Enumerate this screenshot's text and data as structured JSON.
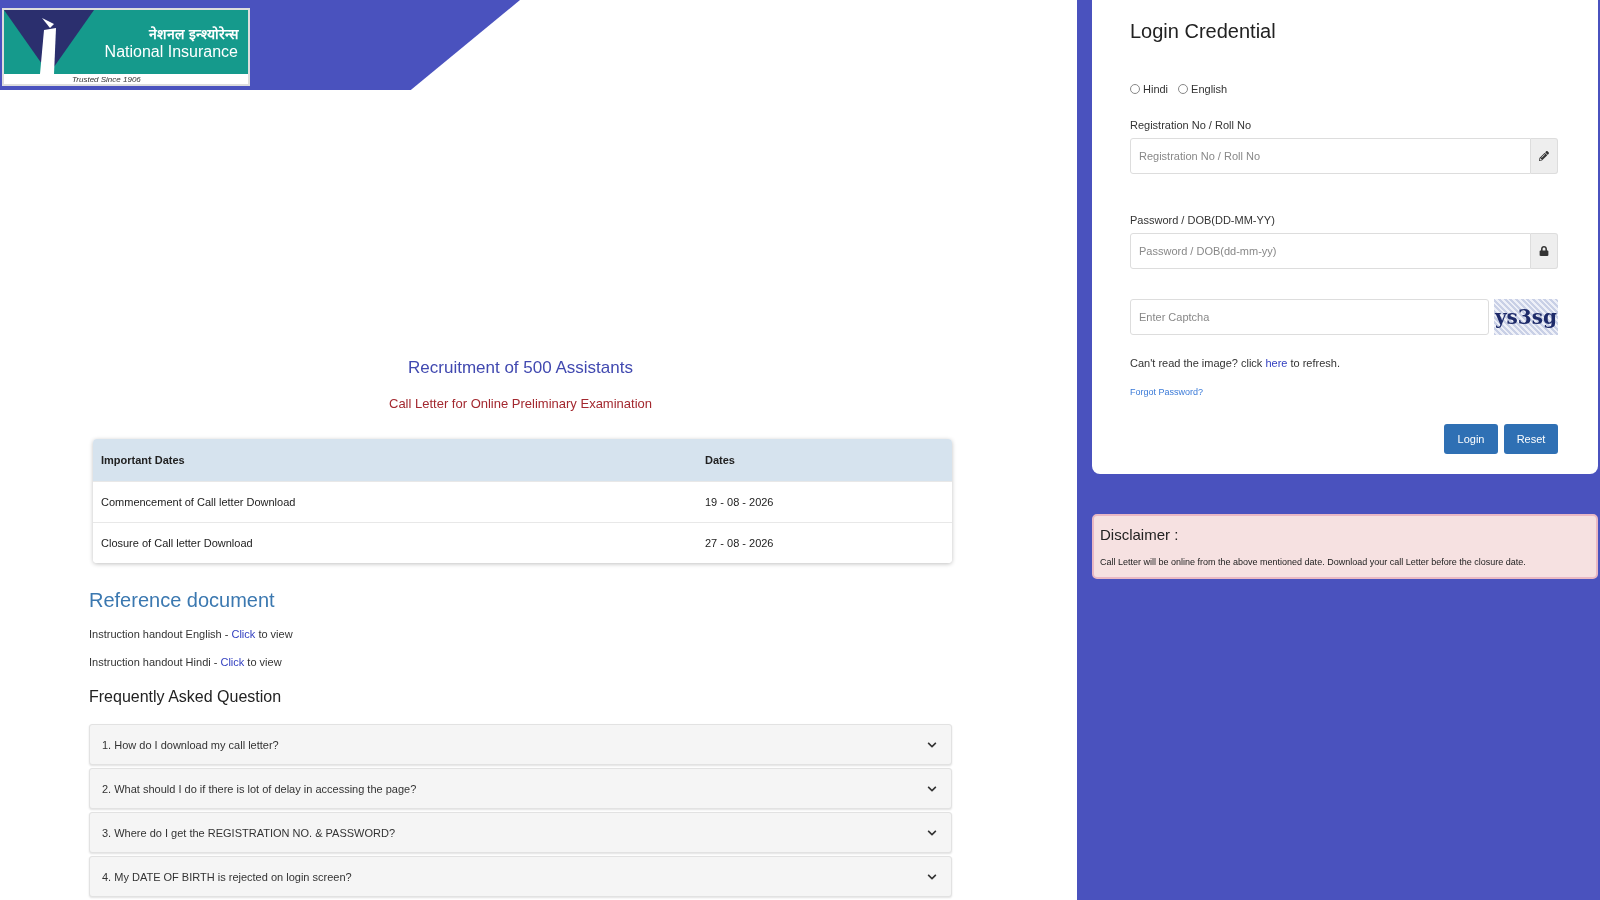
{
  "logo": {
    "hindi": "नेशनल इन्श्योरेन्स",
    "english": "National Insurance",
    "tagline": "Trusted Since 1906"
  },
  "title": "Recruitment of 500 Assistants",
  "subtitle": "Call Letter for Online Preliminary Examination",
  "table": {
    "columns": [
      "Important Dates",
      "Dates"
    ],
    "rows": [
      [
        "Commencement of Call letter Download",
        "19 - 08 - 2026"
      ],
      [
        "Closure of Call letter Download",
        "27 - 08 - 2026"
      ]
    ]
  },
  "reference": {
    "heading": "Reference document",
    "items": [
      {
        "before": "Instruction handout English - ",
        "link": "Click",
        "after": " to view"
      },
      {
        "before": "Instruction handout Hindi - ",
        "link": "Click",
        "after": " to view"
      }
    ]
  },
  "faq": {
    "heading": "Frequently Asked Question",
    "items": [
      {
        "question": "1. How do I download my call letter?",
        "expanded": false
      },
      {
        "question": "2. What should I do if there is lot of delay in accessing the page?",
        "expanded": false
      },
      {
        "question": "3. Where do I get the REGISTRATION NO. & PASSWORD?",
        "expanded": false
      },
      {
        "question": "4. My DATE OF BIRTH is rejected on login screen?",
        "expanded": false
      }
    ]
  },
  "login": {
    "title": "Login Credential",
    "languages": [
      {
        "label": "Hindi",
        "selected": false
      },
      {
        "label": "English",
        "selected": false
      }
    ],
    "fields": [
      {
        "label": "Registration No / Roll No",
        "placeholder": "Registration No / Roll No",
        "kind": "text"
      },
      {
        "label": "Password / DOB(DD-MM-YY)",
        "placeholder": "Password / DOB(dd-mm-yy)",
        "kind": "password"
      }
    ],
    "captcha": {
      "placeholder": "Enter Captcha",
      "code": "ys3sg"
    },
    "refresh": {
      "before": "Can't read the image? click ",
      "link": "here",
      "after": " to refresh."
    },
    "forgot": "Forgot Password?",
    "buttons": [
      "Login",
      "Reset"
    ]
  },
  "disclaimer": {
    "title": "Disclaimer :",
    "text": "Call Letter will be online from the above mentioned date. Download your call Letter before the closure date."
  }
}
